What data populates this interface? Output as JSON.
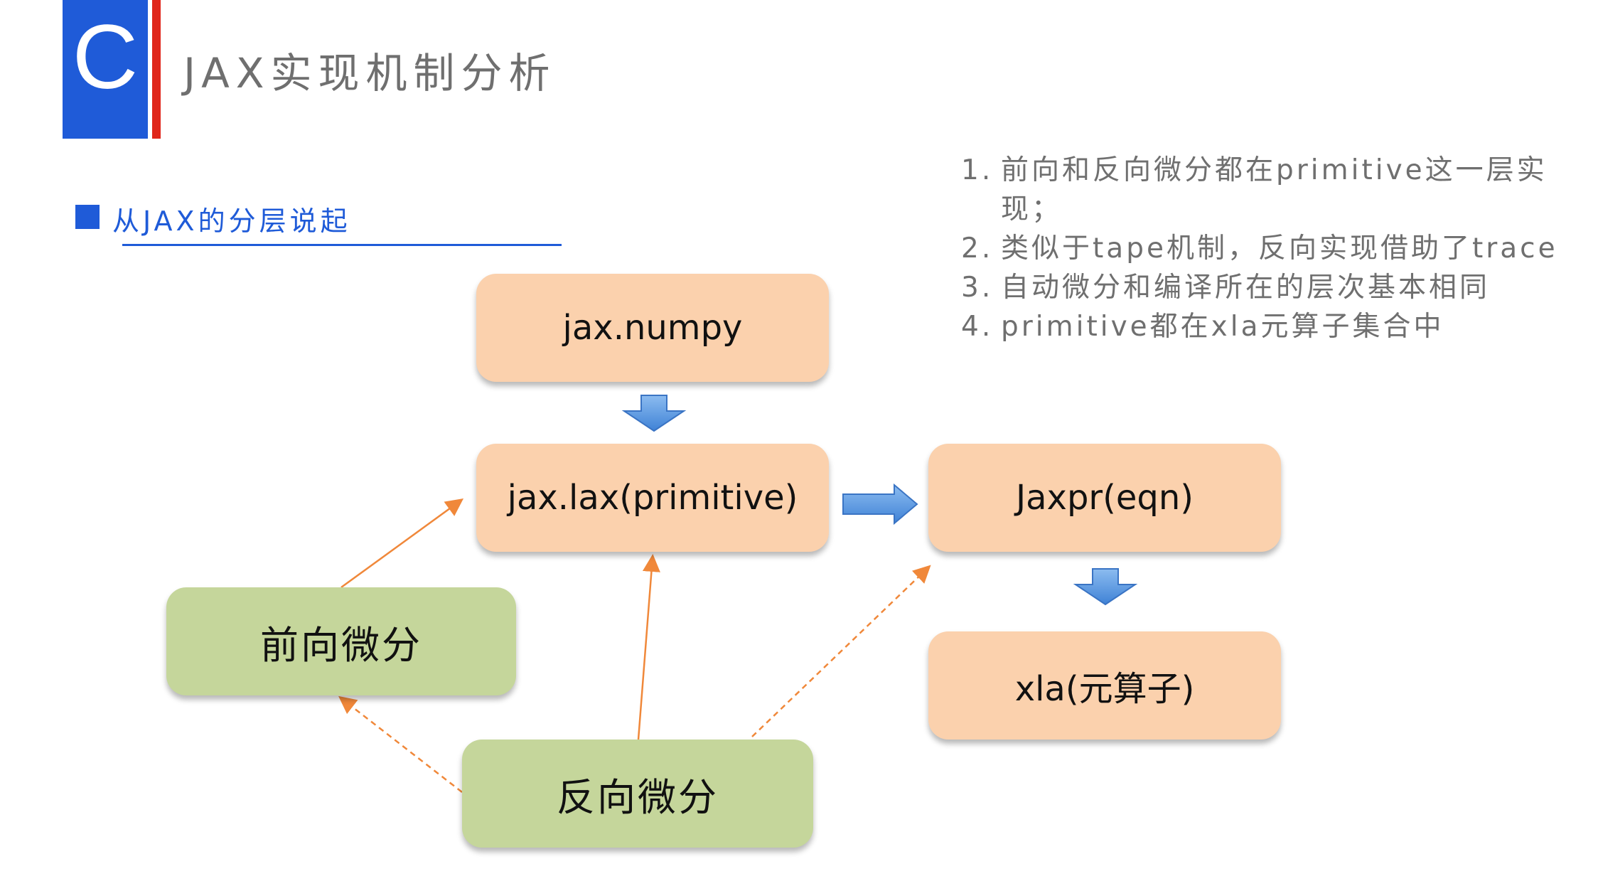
{
  "header": {
    "logo_letter": "C",
    "title": "JAX实现机制分析"
  },
  "section": {
    "title": "从JAX的分层说起"
  },
  "diagram": {
    "nodes": {
      "jax_numpy": "jax.numpy",
      "jax_lax": "jax.lax(primitive)",
      "jaxpr": "Jaxpr(eqn)",
      "xla": "xla(元算子)",
      "forward_diff": "前向微分",
      "reverse_diff": "反向微分"
    }
  },
  "notes": [
    {
      "num": "1.",
      "text": "前向和反向微分都在primitive这一层实现；"
    },
    {
      "num": "2.",
      "text": "类似于tape机制，反向实现借助了trace"
    },
    {
      "num": "3.",
      "text": "自动微分和编译所在的层次基本相同"
    },
    {
      "num": "4.",
      "text": "primitive都在xla元算子集合中"
    }
  ],
  "colors": {
    "brand_blue": "#1f5bd8",
    "accent_red": "#e0261a",
    "box_orange": "#fbd1ad",
    "box_green": "#c5d69b",
    "arrow_orange": "#f0883a",
    "block_arrow_blue": "#5b9be0"
  }
}
